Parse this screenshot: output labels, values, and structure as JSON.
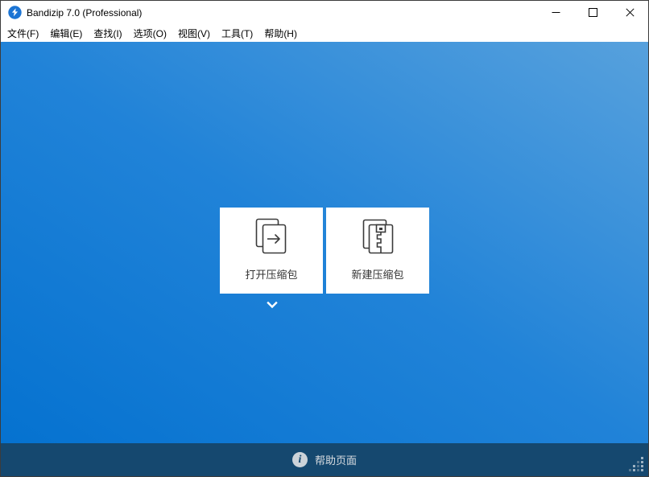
{
  "window": {
    "title": "Bandizip 7.0 (Professional)",
    "app_icon": "bandizip-logo",
    "controls": {
      "minimize": "minimize-icon",
      "maximize": "maximize-icon",
      "close": "close-icon"
    }
  },
  "menubar": {
    "items": [
      {
        "label": "文件(F)"
      },
      {
        "label": "编辑(E)"
      },
      {
        "label": "查找(I)"
      },
      {
        "label": "选项(O)"
      },
      {
        "label": "视图(V)"
      },
      {
        "label": "工具(T)"
      },
      {
        "label": "帮助(H)"
      }
    ]
  },
  "main": {
    "cards": [
      {
        "id": "open-archive",
        "label": "打开压缩包",
        "icon": "open-archive-icon",
        "has_dropdown": true
      },
      {
        "id": "new-archive",
        "label": "新建压缩包",
        "icon": "new-archive-icon",
        "has_dropdown": false
      }
    ],
    "dropdown_chevron": "chevron-down-icon"
  },
  "statusbar": {
    "info_icon_glyph": "i",
    "help_label": "帮助页面",
    "resize_grip": "resize-grip-icon"
  },
  "colors": {
    "gradient_light": "#57a1dd",
    "gradient_mid": "#2183d8",
    "gradient_dark": "#0572d0",
    "statusbar_bg": "#15486f",
    "card_bg": "#ffffff",
    "card_text": "#333333",
    "icon_stroke": "#3a3a3a",
    "logo_blue": "#1b74d4",
    "statusbar_text": "#d9dde1"
  }
}
